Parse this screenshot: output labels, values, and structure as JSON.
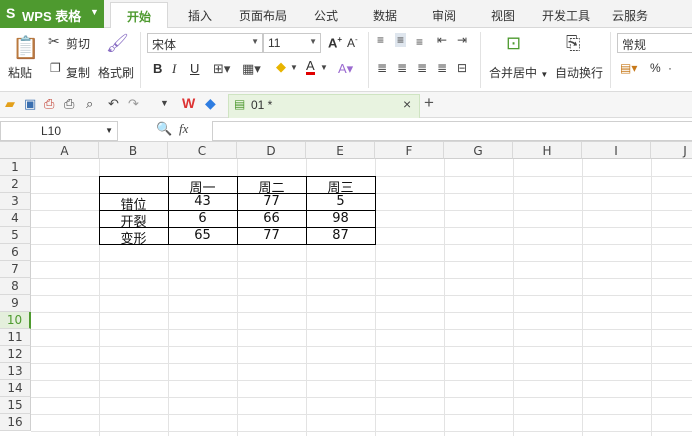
{
  "app": {
    "logo": "S",
    "name": "WPS 表格"
  },
  "menu_tabs": [
    "开始",
    "插入",
    "页面布局",
    "公式",
    "数据",
    "审阅",
    "视图",
    "开发工具",
    "云服务"
  ],
  "ribbon": {
    "paste": "粘贴",
    "cut": "剪切",
    "copy": "复制",
    "format_painter": "格式刷",
    "font_name": "宋体",
    "font_size": "11",
    "bold": "B",
    "italic": "I",
    "underline": "U",
    "merge_center": "合并居中",
    "wrap_text": "自动换行",
    "number_format": "常规",
    "percent": "%"
  },
  "doc_tab": {
    "title": "01 *"
  },
  "name_box": "L10",
  "fx_label": "fx",
  "columns": [
    "A",
    "B",
    "C",
    "D",
    "E",
    "F",
    "G",
    "H",
    "I",
    "J"
  ],
  "rows": [
    "1",
    "2",
    "3",
    "4",
    "5",
    "6",
    "7",
    "8",
    "9",
    "10",
    "11",
    "12",
    "13",
    "14",
    "15",
    "16"
  ],
  "table": {
    "header": [
      "",
      "周一",
      "周二",
      "周三"
    ],
    "rows": [
      [
        "错位",
        "43",
        "77",
        "5"
      ],
      [
        "开裂",
        "6",
        "66",
        "98"
      ],
      [
        "变形",
        "65",
        "77",
        "87"
      ]
    ]
  },
  "colors": {
    "accent": "#4e9a2f",
    "active_row": "#4e9a2f"
  }
}
